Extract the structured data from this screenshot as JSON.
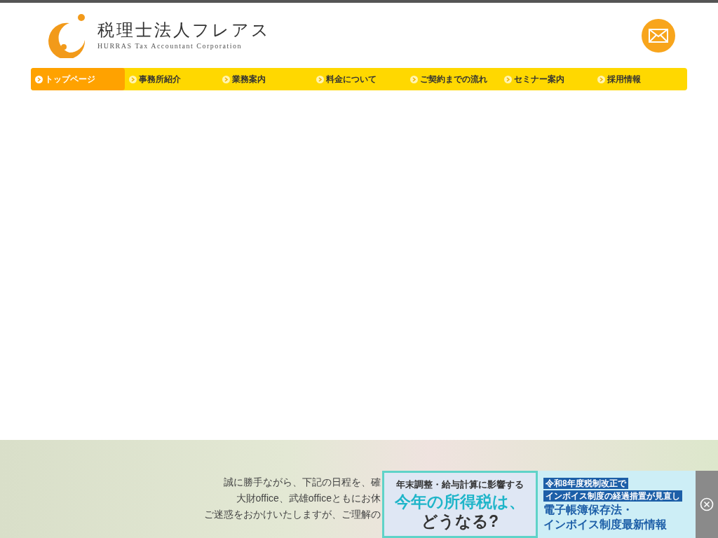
{
  "header": {
    "logo_title": "税理士法人フレアス",
    "logo_subtitle": "HURRAS Tax Accountant Corporation"
  },
  "nav": [
    {
      "label": "トップページ",
      "selected": true
    },
    {
      "label": "事務所紹介",
      "selected": false
    },
    {
      "label": "業務案内",
      "selected": false
    },
    {
      "label": "料金について",
      "selected": false
    },
    {
      "label": "ご契約までの流れ",
      "selected": false
    },
    {
      "label": "セミナー案内",
      "selected": false
    },
    {
      "label": "採用情報",
      "selected": false
    }
  ],
  "notice": {
    "lines": [
      "誠に勝手ながら、下記の日程を、確",
      "大財office、武雄officeともにお休",
      "ご迷惑をおかけいたしますが、ご理解の"
    ]
  },
  "banners": [
    {
      "kind": "tax",
      "lines": [
        "年末調整・給与計算に影響する",
        "今年の所得税は、",
        "どうなる?"
      ]
    },
    {
      "kind": "invoice",
      "lines": [
        "令和8年度税制改正で",
        "インボイス制度の経過措置が見直し",
        "電子帳簿保存法・",
        "インボイス制度最新情報"
      ]
    }
  ]
}
